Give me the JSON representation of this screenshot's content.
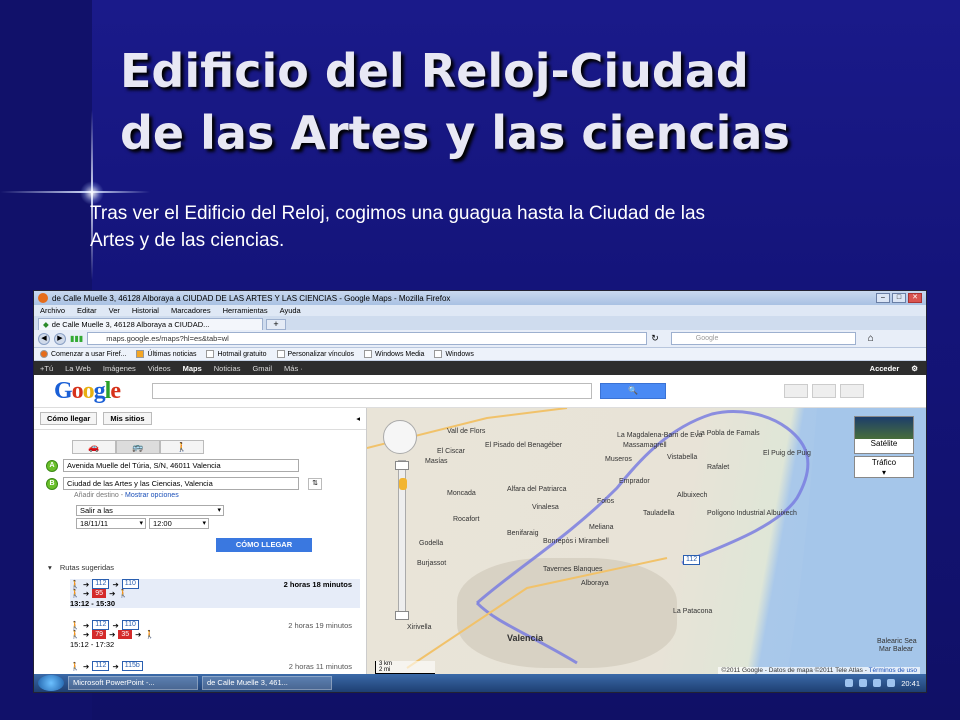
{
  "slide": {
    "title_line1": "Edificio del Reloj-Ciudad",
    "title_line2": "de las Artes y  las ciencias",
    "body_line1": "Tras ver el Edificio del Reloj, cogimos una guagua hasta la Ciudad de las",
    "body_line2": "Artes y de las ciencias."
  },
  "browser": {
    "window_title": "de Calle Muelle 3, 46128 Alboraya a CIUDAD DE LAS ARTES Y LAS CIENCIAS - Google Maps - Mozilla Firefox",
    "menu": [
      "Archivo",
      "Editar",
      "Ver",
      "Historial",
      "Marcadores",
      "Herramientas",
      "Ayuda"
    ],
    "tab_label": "de Calle Muelle 3, 46128 Alboraya a CIUDAD...",
    "tab_new": "+",
    "url": "maps.google.es/maps?hl=es&tab=wl",
    "search_placeholder": "Google",
    "bookmarks": [
      "Comenzar a usar Firef...",
      "Últimas noticias",
      "Hotmail gratuito",
      "Personalizar vínculos",
      "Windows Media",
      "Windows"
    ]
  },
  "google_bar": {
    "links": [
      "+Tú",
      "La Web",
      "Imágenes",
      "Videos",
      "Maps",
      "Noticias",
      "Gmail",
      "Más ·"
    ],
    "active": "Maps",
    "signin": "Acceder",
    "gear": "⚙"
  },
  "logo": {
    "l1": "G",
    "l2": "o",
    "l3": "o",
    "l4": "g",
    "l5": "l",
    "l6": "e"
  },
  "sidebar": {
    "get_directions": "Cómo llegar",
    "my_places": "Mis sitios",
    "origin_marker": "A",
    "origin": "Avenida Muelle del Túria, S/N, 46011 Valencia",
    "dest_marker": "B",
    "destination": "Ciudad de las Artes y las Ciencias, Valencia",
    "add_destination": "Añadir destino",
    "show_options": "Mostrar opciones",
    "depart": "Salir a las",
    "date": "18/11/11",
    "time": "12:00",
    "go_button": "CÓMO LLEGAR",
    "routes_header": "Rutas sugeridas",
    "routes": [
      {
        "bus1": "112",
        "bus2": "110",
        "red": "95",
        "duration": "2 horas 18 minutos",
        "times": "13:12 - 15:30"
      },
      {
        "bus1": "112",
        "bus2": "110",
        "red": "79",
        "red2": "35",
        "duration": "2 horas 19 minutos",
        "times": "15:12 - 17:32"
      },
      {
        "bus1": "112",
        "bus2": "115b",
        "duration": "2 horas 11 minutos"
      }
    ]
  },
  "map": {
    "labels": [
      "Vall de Flors",
      "El Pisado del Benagéber",
      "Masías",
      "El Ciscar",
      "La Magdalena-Barri de Evá",
      "Massamagrell",
      "La Pobla de Farnals",
      "Museros",
      "Vistabella",
      "Rafalet",
      "El Puig de Puig",
      "Emprador",
      "Moncada",
      "Alfara del Patriarca",
      "Albuixech",
      "Vinalesa",
      "Foios",
      "Tauladella",
      "Rocafort",
      "Meliana",
      "Godella",
      "Bonrepòs i Mirambell",
      "Benifaraig",
      "Burjassot",
      "Tavernes Blanques",
      "Alboraya",
      "Valencia",
      "La Patacona",
      "Xirivella",
      "Polígono Industrial Albuixech",
      "Balearic Sea",
      "Mar Balear"
    ],
    "city_label": "Valencia",
    "satellite": "Satélite",
    "traffic": "Tráfico",
    "copyright": "©2011 Google - Datos de mapa ©2011 Tele Atlas -",
    "terms": "Términos de uso",
    "scale_km": "3 km",
    "scale_mi": "2 mi",
    "bus_label": "112"
  },
  "taskbar": {
    "items": [
      "Microsoft PowerPoint -...",
      "de Calle Muelle 3, 461..."
    ],
    "clock": "20:41"
  }
}
